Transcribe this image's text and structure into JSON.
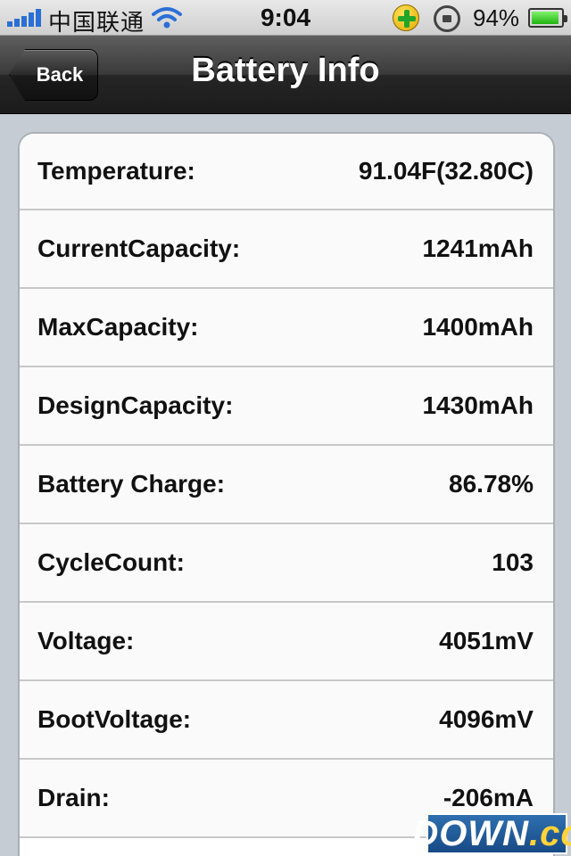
{
  "status_bar": {
    "carrier": "中国联通",
    "time": "9:04",
    "battery_percent": "94%",
    "battery_level": 0.94
  },
  "nav": {
    "back_label": "Back",
    "title": "Battery Info"
  },
  "rows": [
    {
      "label": "Temperature:",
      "value": "91.04F(32.80C)"
    },
    {
      "label": "CurrentCapacity:",
      "value": "1241mAh"
    },
    {
      "label": "MaxCapacity:",
      "value": "1400mAh"
    },
    {
      "label": "DesignCapacity:",
      "value": "1430mAh"
    },
    {
      "label": "Battery Charge:",
      "value": "86.78%"
    },
    {
      "label": "CycleCount:",
      "value": "103"
    },
    {
      "label": "Voltage:",
      "value": "4051mV"
    },
    {
      "label": "BootVoltage:",
      "value": "4096mV"
    },
    {
      "label": "Drain:",
      "value": "-206mA"
    }
  ],
  "watermark": {
    "text": "DOWN",
    "suffix": ".cc"
  }
}
